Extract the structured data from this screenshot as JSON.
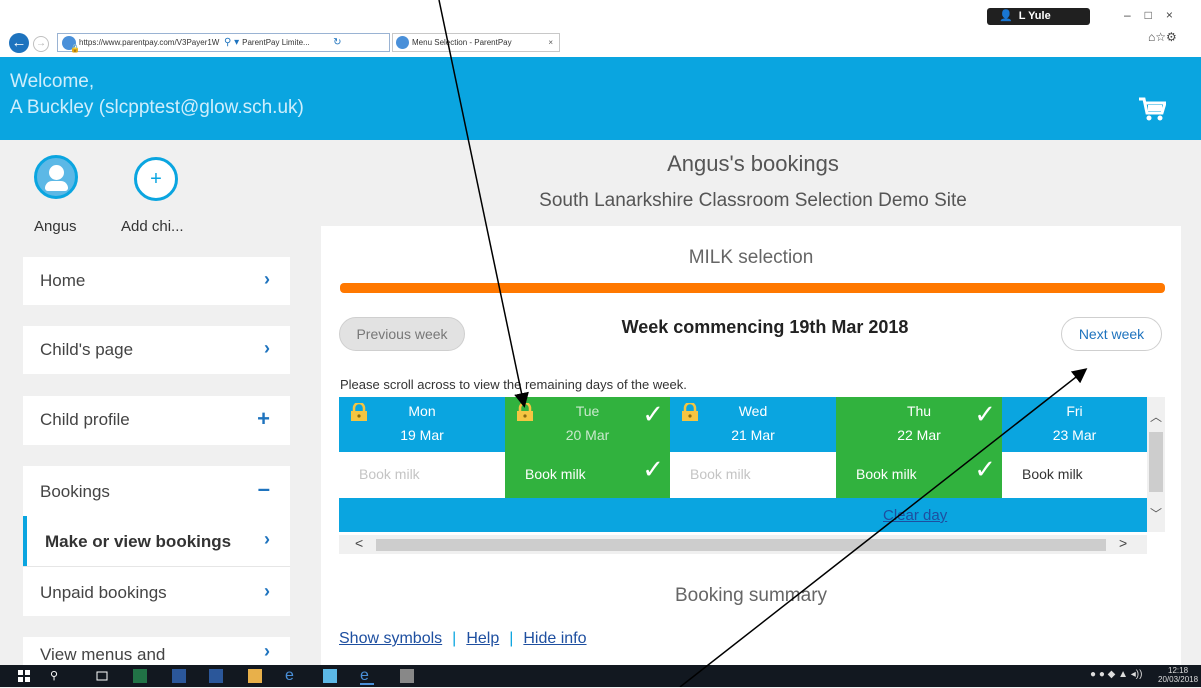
{
  "browser": {
    "url": "https://www.parentpay.com/V3Payer1W",
    "site_label": "ParentPay Limite...",
    "tab_label": "Menu Selection - ParentPay",
    "tab_close": "×",
    "user_name": "L Yule",
    "back_glyph": "←",
    "forward_glyph": "→",
    "window_controls": "–□×",
    "toolbar_icons": "⌂☆⚙"
  },
  "header": {
    "welcome": "Welcome,",
    "user": "A Buckley (slcpptest@glow.sch.uk)",
    "cart_icon": "shopping-cart-icon"
  },
  "sidebar": {
    "children": [
      {
        "label": "Angus",
        "icon": "avatar-icon"
      },
      {
        "label": "Add chi...",
        "icon": "plus-icon"
      }
    ],
    "nav": [
      {
        "label": "Home",
        "icon": "chevron-right-icon"
      },
      {
        "label": "Child's page",
        "icon": "chevron-right-icon"
      },
      {
        "label": "Child profile",
        "icon": "plus-icon"
      },
      {
        "label": "Bookings",
        "icon": "minus-icon"
      },
      {
        "label": "Make or view bookings",
        "icon": "chevron-right-icon"
      },
      {
        "label": "Unpaid bookings",
        "icon": "chevron-right-icon"
      },
      {
        "label": "View menus and",
        "icon": "chevron-right-icon"
      }
    ]
  },
  "main": {
    "title": "Angus's bookings",
    "subtitle": "South Lanarkshire Classroom Selection Demo Site",
    "section": "MILK selection",
    "prev_week": "Previous week",
    "week_commencing": "Week commencing 19th Mar 2018",
    "next_week": "Next week",
    "scroll_message": "Please scroll across to view the remaining days of the week.",
    "days": [
      {
        "name": "Mon",
        "date": "19 Mar",
        "locked": true,
        "selected": false,
        "book": "Book milk",
        "booked": false
      },
      {
        "name": "Tue",
        "date": "20 Mar",
        "locked": true,
        "selected": true,
        "book": "Book milk",
        "booked": true
      },
      {
        "name": "Wed",
        "date": "21 Mar",
        "locked": true,
        "selected": false,
        "book": "Book milk",
        "booked": false
      },
      {
        "name": "Thu",
        "date": "22 Mar",
        "locked": false,
        "selected": true,
        "book": "Book milk",
        "booked": true
      },
      {
        "name": "Fri",
        "date": "23 Mar",
        "locked": false,
        "selected": false,
        "book": "Book milk",
        "booked": false
      }
    ],
    "clear_day": "Clear day",
    "summary": "Booking summary",
    "links": {
      "show_symbols": "Show symbols",
      "help": "Help",
      "hide_info": "Hide info"
    },
    "tick_glyph": "✓"
  },
  "taskbar": {
    "time": "12:18",
    "date": "20/03/2018"
  },
  "colors": {
    "header_blue": "#0aa5e0",
    "booked_green": "#31b23e",
    "progress_orange": "#ff7800",
    "link_blue": "#1e4fa0"
  }
}
